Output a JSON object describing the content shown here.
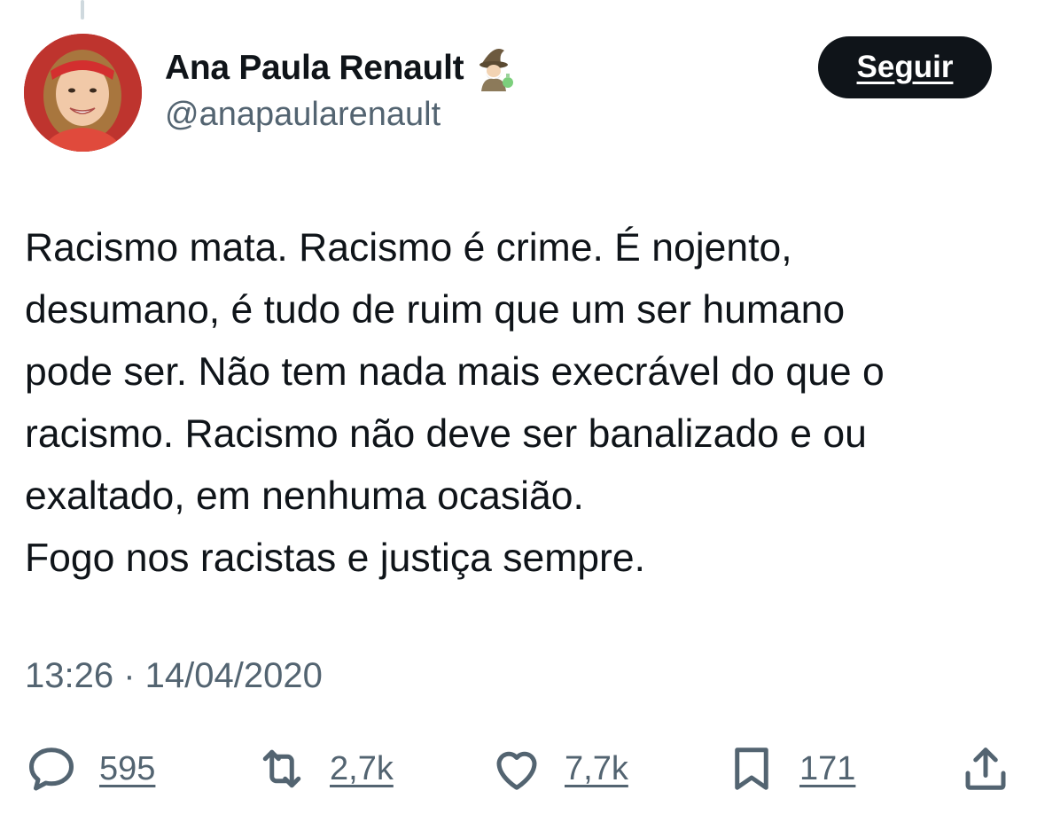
{
  "tweet": {
    "author": {
      "display_name": "Ana Paula Renault",
      "handle": "@anapaularenault",
      "badge_icon": "wizard-emoji-icon"
    },
    "follow_label": "Seguir",
    "text_lines": [
      "Racismo mata. Racismo é crime. É nojento,",
      "desumano, é tudo de ruim que um ser humano",
      "pode ser. Não tem nada mais execrável do que o",
      "racismo. Racismo não deve ser banalizado e ou",
      "exaltado, em nenhuma ocasião.",
      "Fogo nos racistas e justiça sempre."
    ],
    "timestamp": "13:26 · 14/04/2020",
    "actions": {
      "replies": {
        "icon": "reply-icon",
        "count": "595"
      },
      "retweets": {
        "icon": "retweet-icon",
        "count": "2,7k"
      },
      "likes": {
        "icon": "heart-icon",
        "count": "7,7k"
      },
      "bookmarks": {
        "icon": "bookmark-icon",
        "count": "171"
      },
      "share": {
        "icon": "share-icon"
      }
    }
  },
  "colors": {
    "text_primary": "#0f1419",
    "text_secondary": "#536471",
    "button_bg": "#0f1419",
    "thread_line": "#cfd9de"
  }
}
